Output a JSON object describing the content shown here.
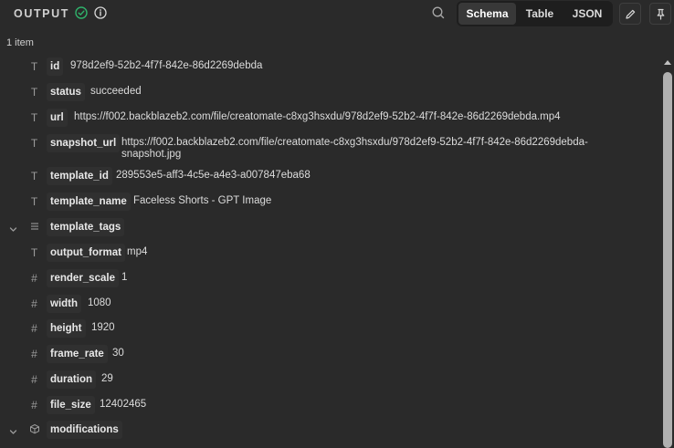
{
  "header": {
    "title": "OUTPUT",
    "tabs": [
      {
        "label": "Schema",
        "active": true
      },
      {
        "label": "Table",
        "active": false
      },
      {
        "label": "JSON",
        "active": false
      }
    ]
  },
  "item_count": "1 item",
  "fields": [
    {
      "key": "id",
      "value": "978d2ef9-52b2-4f7f-842e-86d2269debda",
      "type": "string"
    },
    {
      "key": "status",
      "value": "succeeded",
      "type": "string"
    },
    {
      "key": "url",
      "value": "https://f002.backblazeb2.com/file/creatomate-c8xg3hsxdu/978d2ef9-52b2-4f7f-842e-86d2269debda.mp4",
      "type": "string"
    },
    {
      "key": "snapshot_url",
      "value": "https://f002.backblazeb2.com/file/creatomate-c8xg3hsxdu/978d2ef9-52b2-4f7f-842e-86d2269debda-",
      "value2": "snapshot.jpg",
      "type": "string"
    },
    {
      "key": "template_id",
      "value": "289553e5-aff3-4c5e-a4e3-a007847eba68",
      "type": "string"
    },
    {
      "key": "template_name",
      "value": "Faceless Shorts - GPT Image",
      "type": "string"
    },
    {
      "key": "template_tags",
      "value": "",
      "type": "array",
      "expandable": true
    },
    {
      "key": "output_format",
      "value": "mp4",
      "type": "string"
    },
    {
      "key": "render_scale",
      "value": "1",
      "type": "number"
    },
    {
      "key": "width",
      "value": "1080",
      "type": "number"
    },
    {
      "key": "height",
      "value": "1920",
      "type": "number"
    },
    {
      "key": "frame_rate",
      "value": "30",
      "type": "number"
    },
    {
      "key": "duration",
      "value": "29",
      "type": "number"
    },
    {
      "key": "file_size",
      "value": "12402465",
      "type": "number"
    },
    {
      "key": "modifications",
      "value": "",
      "type": "object",
      "expandable": true
    }
  ],
  "colors": {
    "background": "#2a2a2a",
    "success": "#2fb36b",
    "key_chip": "#303030"
  }
}
